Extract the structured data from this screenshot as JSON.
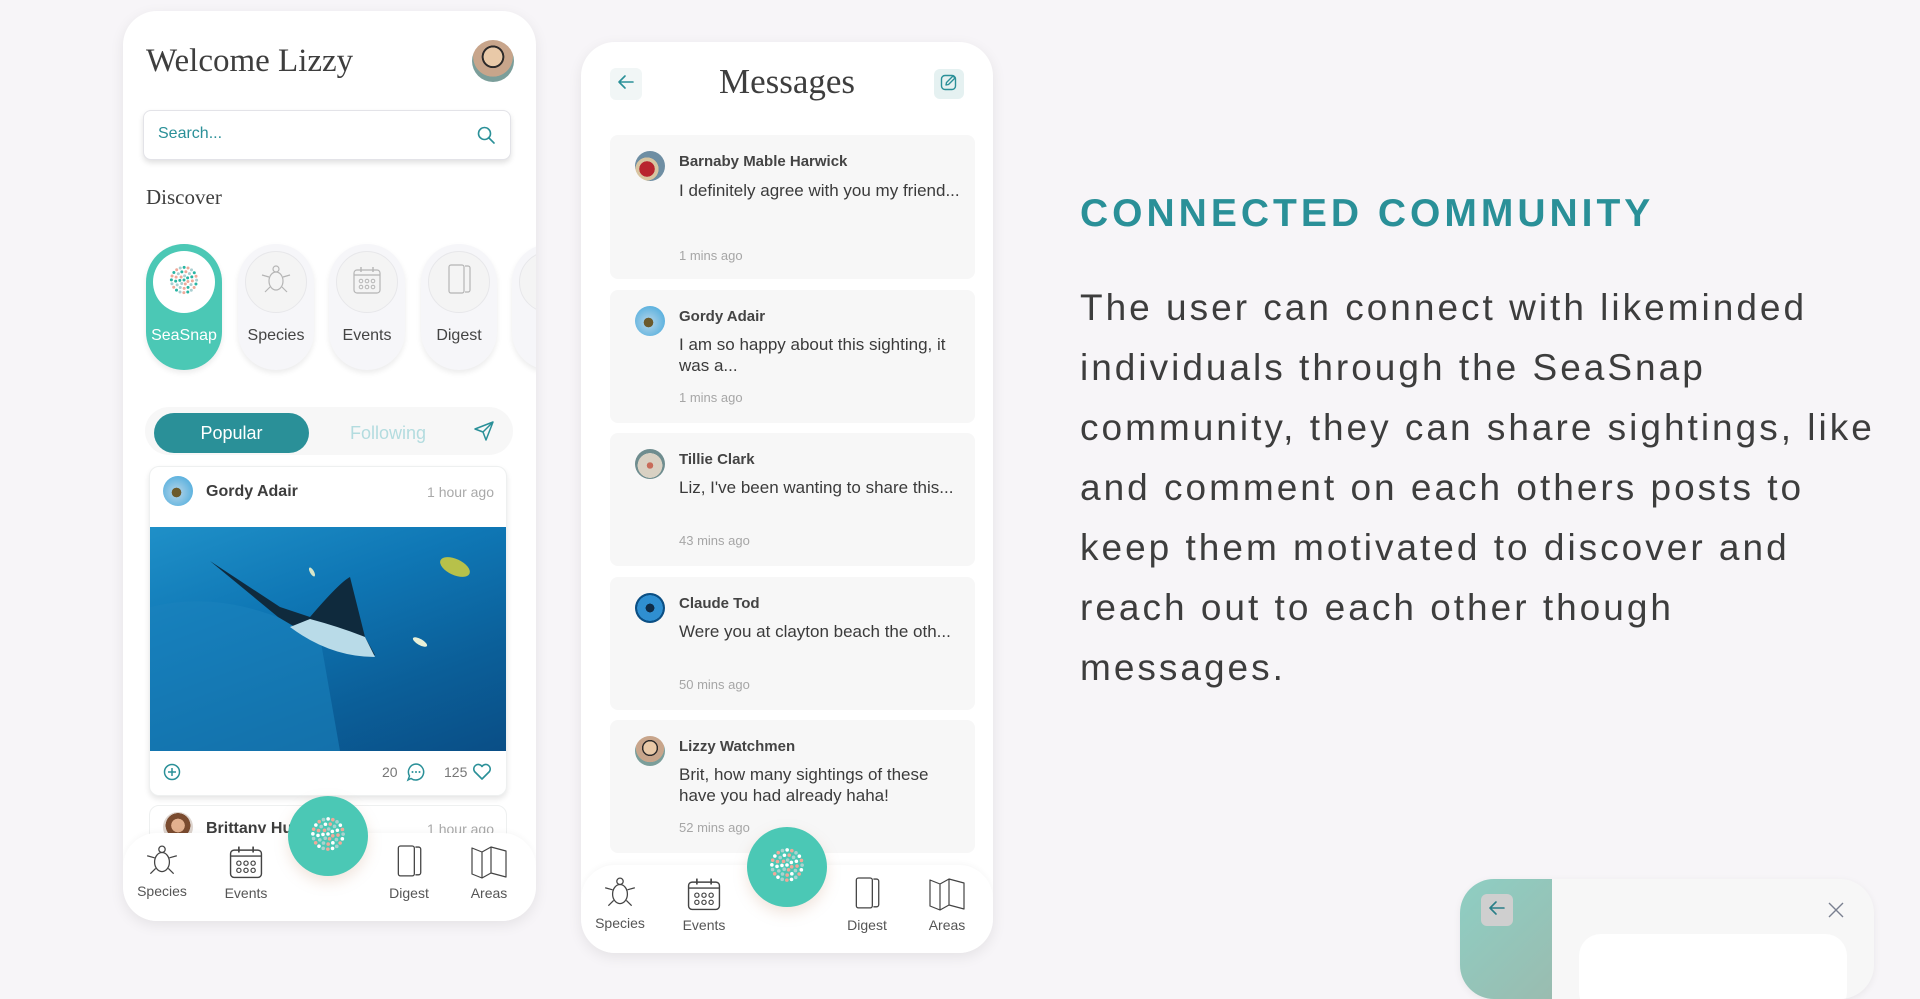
{
  "home": {
    "title": "Welcome Lizzy",
    "search_placeholder": "Search...",
    "discover_label": "Discover",
    "chips": [
      {
        "label": "SeaSnap",
        "icon": "seasnap-logo-icon",
        "active": true
      },
      {
        "label": "Species",
        "icon": "turtle-icon",
        "active": false
      },
      {
        "label": "Events",
        "icon": "calendar-icon",
        "active": false
      },
      {
        "label": "Digest",
        "icon": "notebook-icon",
        "active": false
      }
    ],
    "tabs": {
      "popular": "Popular",
      "following": "Following",
      "active": "Popular"
    },
    "posts": [
      {
        "author": "Gordy Adair",
        "time": "1 hour ago",
        "comments": "20",
        "likes": "125"
      },
      {
        "author": "Brittany Huff",
        "time": "1 hour ago"
      }
    ],
    "nav": {
      "species": "Species",
      "events": "Events",
      "digest": "Digest",
      "areas": "Areas"
    }
  },
  "messages": {
    "title": "Messages",
    "items": [
      {
        "name": "Barnaby Mable Harwick",
        "text": "I definitely agree with you my friend...",
        "time": "1 mins ago"
      },
      {
        "name": "Gordy Adair",
        "text": "I am so happy about this sighting, it was a...",
        "time": "1 mins ago"
      },
      {
        "name": "Tillie Clark",
        "text": "Liz, I've been wanting to share this...",
        "time": "43 mins ago"
      },
      {
        "name": "Claude Tod",
        "text": "Were you at clayton beach the oth...",
        "time": "50 mins ago"
      },
      {
        "name": "Lizzy Watchmen",
        "text": "Brit, how many sightings of these have you had already haha!",
        "time": "52 mins ago"
      }
    ],
    "nav": {
      "species": "Species",
      "events": "Events",
      "digest": "Digest",
      "areas": "Areas"
    }
  },
  "feature": {
    "heading": "CONNECTED COMMUNITY",
    "body": "The user can connect with likeminded individuals through the SeaSnap community, they can share sightings, like and comment on each others posts to keep them motivated to discover and reach out to each other though messages."
  },
  "colors": {
    "teal": "#2a9098",
    "mint": "#4bc8b5",
    "background": "#f7f5f8"
  }
}
